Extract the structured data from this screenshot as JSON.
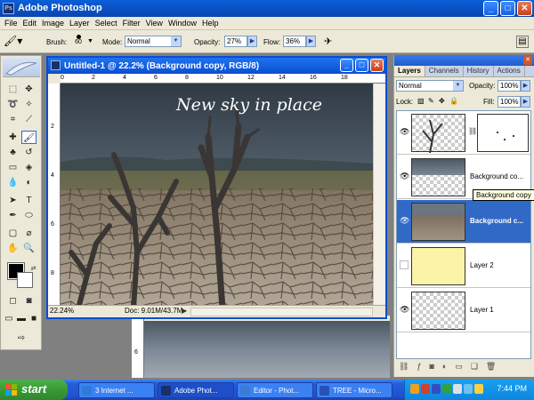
{
  "window": {
    "title": "Adobe Photoshop",
    "icon_text": "Ps",
    "min_glyph": "_",
    "max_glyph": "□",
    "close_glyph": "✕"
  },
  "menu": [
    "File",
    "Edit",
    "Image",
    "Layer",
    "Select",
    "Filter",
    "View",
    "Window",
    "Help"
  ],
  "options": {
    "brush_label": "Brush:",
    "brush_size": "60",
    "mode_label": "Mode:",
    "mode_value": "Normal",
    "opacity_label": "Opacity:",
    "opacity_value": "27%",
    "flow_label": "Flow:",
    "flow_value": "36%"
  },
  "document": {
    "title": "Untitled-1 @ 22.2% (Background copy, RGB/8)",
    "canvas_text": "New sky in place",
    "zoom": "22.24%",
    "status": "Doc: 9.01M/43.7M",
    "ruler_h": [
      "0",
      "2",
      "4",
      "6",
      "8",
      "10",
      "12",
      "14",
      "16",
      "18"
    ],
    "ruler_v": [
      "2",
      "4",
      "6",
      "8"
    ],
    "behind_ruler": [
      "6"
    ]
  },
  "layers_palette": {
    "tabs": [
      "Layers",
      "Channels",
      "History",
      "Actions"
    ],
    "blend_mode": "Normal",
    "opacity_label": "Opacity:",
    "opacity_value": "100%",
    "lock_label": "Lock:",
    "fill_label": "Fill:",
    "fill_value": "100%",
    "layers": [
      {
        "name": "",
        "visible": true,
        "has_mask": true,
        "active": false
      },
      {
        "name": "Background co...",
        "visible": true,
        "active": false
      },
      {
        "name": "Background c...",
        "visible": true,
        "active": true
      },
      {
        "name": "Layer 2",
        "visible": false,
        "active": false
      },
      {
        "name": "Layer 1",
        "visible": true,
        "active": false
      }
    ],
    "tooltip": "Background copy"
  },
  "taskbar": {
    "start_label": "start",
    "tasks": [
      {
        "label": "3 Internet ...",
        "color": "#2f7ad8"
      },
      {
        "label": "Adobe Phot...",
        "color": "#1b2f6b"
      },
      {
        "label": "Editor - Phot...",
        "color": "#3a7bd5"
      },
      {
        "label": "TREE - Micro...",
        "color": "#2850b8"
      }
    ],
    "clock": "7:44 PM"
  },
  "colors": {
    "sky": "#3d4a56",
    "ground": "#8a7d70"
  }
}
